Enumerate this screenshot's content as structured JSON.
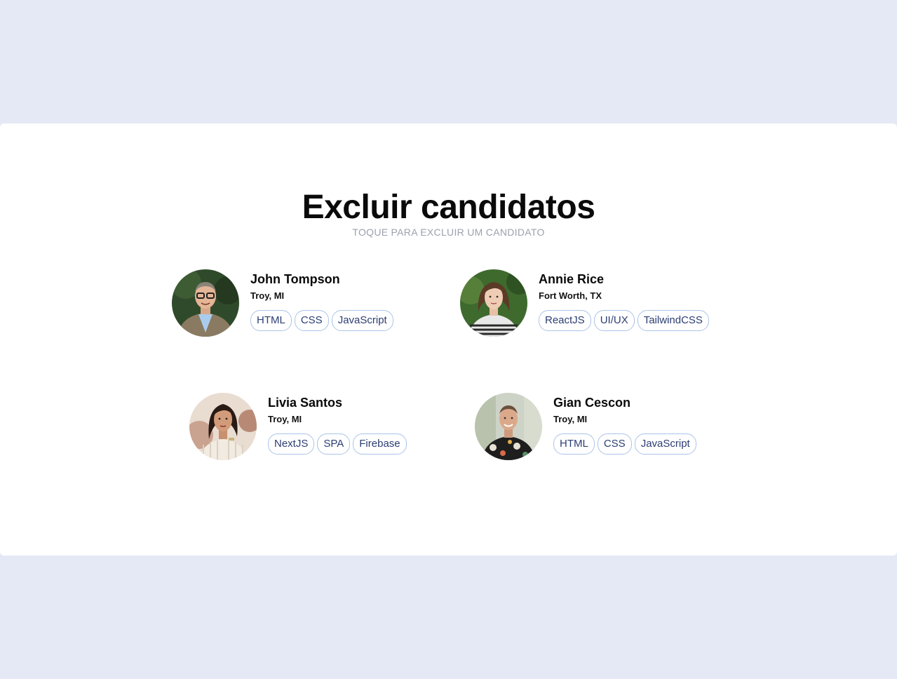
{
  "page": {
    "title": "Excluir candidatos",
    "subtitle": "TOQUE PARA EXCLUIR UM CANDIDATO"
  },
  "colors": {
    "background": "#e5e9f5",
    "panel": "#ffffff",
    "tag_text": "#2c3e73",
    "tag_border": "#aac4e8",
    "subtitle": "#9aa1ad"
  },
  "candidates": [
    {
      "name": "John Tompson",
      "location": "Troy, MI",
      "tags": [
        "HTML",
        "CSS",
        "JavaScript"
      ]
    },
    {
      "name": "Annie Rice",
      "location": "Fort Worth, TX",
      "tags": [
        "ReactJS",
        "UI/UX",
        "TailwindCSS"
      ]
    },
    {
      "name": "Livia Santos",
      "location": "Troy, MI",
      "tags": [
        "NextJS",
        "SPA",
        "Firebase"
      ]
    },
    {
      "name": "Gian Cescon",
      "location": "Troy, MI",
      "tags": [
        "HTML",
        "CSS",
        "JavaScript"
      ]
    }
  ]
}
